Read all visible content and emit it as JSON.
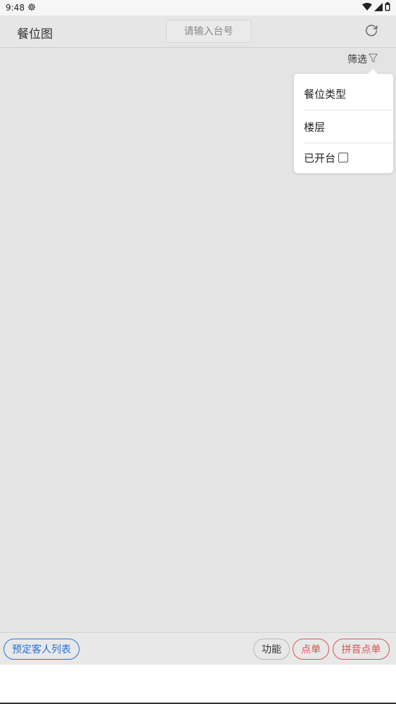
{
  "status_bar": {
    "time": "9:48",
    "settings_icon": "gear-icon",
    "icons": [
      "wifi-icon",
      "signal-icon",
      "battery-icon"
    ]
  },
  "header": {
    "title": "餐位图",
    "search_placeholder": "请输入台号",
    "refresh_icon": "refresh-icon"
  },
  "filter": {
    "label": "筛选",
    "icon": "funnel-icon",
    "menu": {
      "item_seat_type": "餐位类型",
      "item_floor": "楼层",
      "item_opened": "已开台"
    }
  },
  "bottom_bar": {
    "reserve_list": "预定客人列表",
    "function": "功能",
    "order": "点单",
    "pinyin_order": "拼音点单"
  },
  "colors": {
    "accent_blue": "#2a6fd6",
    "accent_red": "#d9534f",
    "background": "#e4e4e4"
  }
}
